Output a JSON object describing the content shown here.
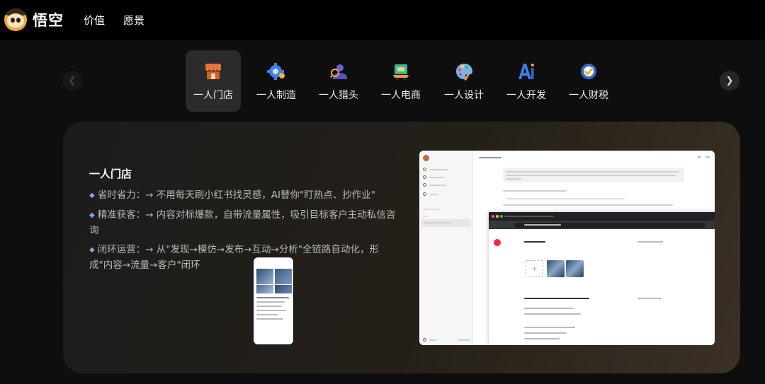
{
  "header": {
    "brand": "悟空",
    "nav": [
      "价值",
      "愿景"
    ]
  },
  "carousel": {
    "active_index": 0,
    "tabs": [
      {
        "label": "一人门店",
        "icon": "storefront-icon"
      },
      {
        "label": "一人制造",
        "icon": "gear-icon"
      },
      {
        "label": "一人猎头",
        "icon": "person-hunter-icon"
      },
      {
        "label": "一人电商",
        "icon": "shopping-cart-icon"
      },
      {
        "label": "一人设计",
        "icon": "palette-icon"
      },
      {
        "label": "一人开发",
        "icon": "ai-icon"
      },
      {
        "label": "一人财税",
        "icon": "finance-check-icon"
      }
    ],
    "prev_icon": "chevron-left-icon",
    "next_icon": "chevron-right-icon"
  },
  "detail": {
    "title": "一人门店",
    "bullets": [
      "省时省力：→ 不用每天刷小红书找灵感，AI替你\"盯热点、抄作业\"",
      "精准获客：→ 内容对标爆款，自带流量属性，吸引目标客户主动私信咨询",
      "闭环运营：→ 从\"发现→模仿→发布→互动→分析\"全链路自动化，形成\"内容→流量→客户\"闭环"
    ]
  },
  "colors": {
    "accent_bullet": "#7da7e6",
    "tab_active_bg": "#2b2b2b",
    "card_warm": "#3b3124"
  }
}
